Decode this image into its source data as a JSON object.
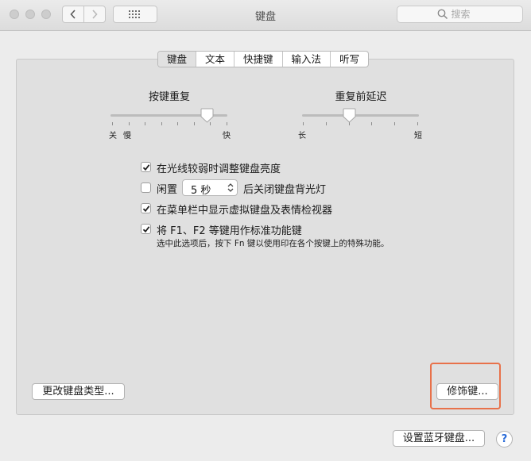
{
  "window": {
    "title": "键盘",
    "search_placeholder": "搜索"
  },
  "icons": {
    "back": "chevron-left-icon",
    "forward": "chevron-right-icon",
    "grid": "grid-icon",
    "search": "search-icon",
    "checkmark": "checkmark-icon",
    "stepper": "stepper-arrows-icon",
    "help": "help-icon"
  },
  "tabs": [
    "键盘",
    "文本",
    "快捷键",
    "输入法",
    "听写"
  ],
  "active_tab": "键盘",
  "sliders": {
    "key_repeat": {
      "title": "按键重复",
      "label_left_1": "关",
      "label_left_2": "慢",
      "label_right": "快",
      "value": 0.85
    },
    "delay": {
      "title": "重复前延迟",
      "label_left": "长",
      "label_right": "短",
      "value": 0.4
    }
  },
  "options": {
    "adjust_brightness": {
      "label": "在光线较弱时调整键盘亮度",
      "checked": true
    },
    "idle_prefix": "闲置",
    "idle_value": "5 秒",
    "idle_suffix": "后关闭键盘背光灯",
    "idle_checked": false,
    "show_viewer": {
      "label": "在菜单栏中显示虚拟键盘及表情检视器",
      "checked": true
    },
    "fn_keys": {
      "label": "将 F1、F2 等键用作标准功能键",
      "note": "选中此选项后，按下 Fn 键以使用印在各个按键上的特殊功能。",
      "checked": true
    }
  },
  "buttons": {
    "change_type": "更改键盘类型...",
    "modifier": "修饰键...",
    "bluetooth": "设置蓝牙键盘...",
    "help": "?"
  },
  "colors": {
    "highlight": "#e8714a",
    "help_glyph": "#2a6bd8"
  }
}
